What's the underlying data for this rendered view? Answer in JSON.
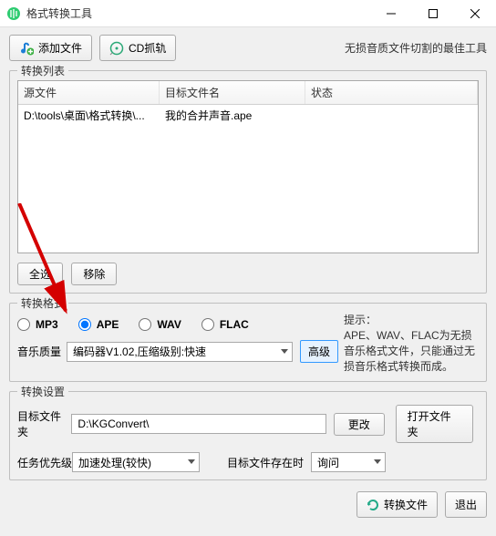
{
  "window": {
    "title": "格式转换工具"
  },
  "toolbar": {
    "add_file": "添加文件",
    "cd_rip": "CD抓轨",
    "tagline": "无损音质文件切割的最佳工具"
  },
  "list_group": {
    "legend": "转换列表",
    "columns": {
      "source": "源文件",
      "target": "目标文件名",
      "status": "状态"
    },
    "rows": [
      {
        "source": "D:\\tools\\桌面\\格式转换\\...",
        "target": "我的合并声音.ape",
        "status": ""
      }
    ],
    "select_all": "全选",
    "remove": "移除"
  },
  "format_group": {
    "legend": "转换格式",
    "options": {
      "mp3": "MP3",
      "ape": "APE",
      "wav": "WAV",
      "flac": "FLAC"
    },
    "selected": "ape",
    "hint_label": "提示：",
    "hint_text": "APE、WAV、FLAC为无损音乐格式文件，只能通过无损音乐格式转换而成。",
    "quality_label": "音乐质量",
    "quality_value": "编码器V1.02,压缩级别:快速",
    "advanced": "高级"
  },
  "settings_group": {
    "legend": "转换设置",
    "dest_label": "目标文件夹",
    "dest_value": "D:\\KGConvert\\",
    "change": "更改",
    "open_folder": "打开文件夹",
    "priority_label": "任务优先级",
    "priority_value": "加速处理(较快)",
    "exist_label": "目标文件存在时",
    "exist_value": "询问"
  },
  "footer": {
    "convert": "转换文件",
    "exit": "退出"
  }
}
